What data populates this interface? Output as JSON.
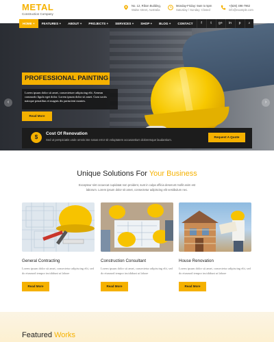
{
  "logo": {
    "name": "METAL",
    "tagline": "Construction Company"
  },
  "topinfo": [
    {
      "icon": "map-pin-icon",
      "line1": "No. 12, Ribon Building,",
      "line2": "Walse street, Australia"
    },
    {
      "icon": "clock-icon",
      "line1": "Monday-Friday: 9am to 5pm",
      "line2": "Saturday / Sunday: Closed"
    },
    {
      "icon": "phone-icon",
      "line1": "+(526) 496-7962",
      "line2": "info@example.com"
    }
  ],
  "nav": {
    "items": [
      "HOME +",
      "FEATURES +",
      "ABOUT +",
      "PROJECTS +",
      "SERVICES +",
      "SHOP +",
      "BLOG +",
      "CONTACT"
    ],
    "socials": [
      "f",
      "t",
      "g+",
      "in",
      "p",
      "⌕"
    ]
  },
  "hero": {
    "title": "PROFESSIONAL PAINTING",
    "text": "Lorem ipsum dolor sit amet, consectetuer adipiscing elit. Aenean commodo ligula eget dolor. Lorem ipsum dolor sit amet. Cum sociis natoque penatibus et magnis dis parturient montes.",
    "button": "Read More",
    "prev": "‹",
    "next": "›"
  },
  "cost": {
    "icon_symbol": "$",
    "title": "Cost Of Renovation",
    "text": "Sed ut perspiciatis unde omnis iste natus error sit voluptatem accusantium doloremque laudantium.",
    "button": "Request A Quote"
  },
  "solutions": {
    "title_plain": "Unique Solutions For ",
    "title_highlight": "Your Business",
    "desc": "Excepteur sint occaecat cupidatat non proident, sunt in culpa officia deserunt mollit anim est laborum. Lorem ipsum dolor sit amet, consectetur adipiscing elit vestibulum nec."
  },
  "cards": [
    {
      "title": "General Contracting",
      "desc": "Lorem ipsum dolor sit amet, consectetur adipiscing elit, sed do eiusmod tempor incididunt ut labore",
      "button": "Read More"
    },
    {
      "title": "Construction Consultant",
      "desc": "Lorem ipsum dolor sit amet, consectetur adipiscing elit, sed do eiusmod tempor incididunt ut labore",
      "button": "Read More"
    },
    {
      "title": "House Renovation",
      "desc": "Lorem ipsum dolor sit amet, consectetur adipiscing elit, sed do eiusmod tempor incididunt ut labore",
      "button": "Read More"
    }
  ],
  "featured": {
    "title_plain": "Featured ",
    "title_highlight": "Works"
  },
  "colors": {
    "accent": "#f5b100",
    "dark": "#1f1f1f"
  }
}
